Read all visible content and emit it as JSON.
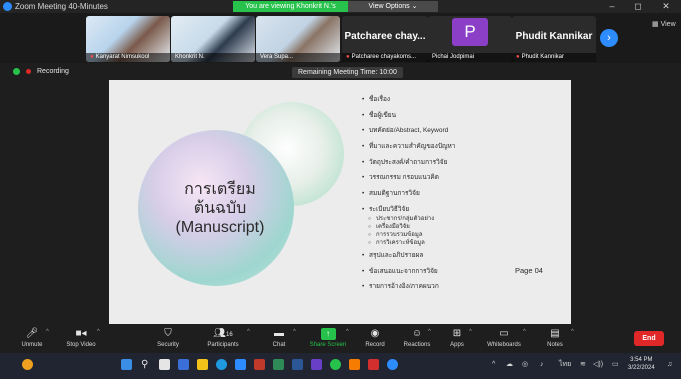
{
  "window": {
    "title": "Zoom Meeting 40-Minutes",
    "viewing_banner": "You are viewing Khonkrit N.'s screen",
    "view_options": "View Options",
    "view_options_caret": "⌄",
    "minimize": "–",
    "maximize": "◻",
    "close": "✕"
  },
  "gallery": {
    "participants": [
      {
        "name": "Kanyarat Nimsukool"
      },
      {
        "name": "Khonkrit N."
      },
      {
        "name": "Vera Supa..."
      },
      {
        "name": "Patcharee chayakoms...",
        "display_name": "Patcharee chay..."
      },
      {
        "name": "Pichai Jodpimai",
        "avatar_letter": "P"
      },
      {
        "name": "Phudit Kannikar",
        "display_name": "Phudit Kannikar"
      }
    ],
    "next_glyph": "›",
    "view_label": "View"
  },
  "status": {
    "recording_label": "Recording",
    "remaining_time": "Remaining Meeting Time: 10:00"
  },
  "slide": {
    "title_line1": "การเตรียม",
    "title_line2": "ต้นฉบับ",
    "title_line3": "(Manuscript)",
    "outline": [
      "ชื่อเรื่อง",
      "ชื่อผู้เขียน",
      "บทคัดย่อ/Abstract, Keyword",
      "ที่มาและความสำคัญของปัญหา",
      "วัตถุประสงค์/คำถามการวิจัย",
      "วรรณกรรม กรอบแนวคิด",
      "สมมติฐานการวิจัย",
      "ระเบียบวิธีวิจัย"
    ],
    "sub_outline": [
      "ประชากร/กลุ่มตัวอย่าง",
      "เครื่องมือวิจัย",
      "การรวบรวมข้อมูล",
      "การวิเคราะห์ข้อมูล"
    ],
    "outline_after": [
      "สรุปและอภิปรายผล",
      "ข้อเสนอแนะจากการวิจัย",
      "รายการอ้างอิง/ภาคผนวก"
    ],
    "page_label": "Page 04"
  },
  "toolbar": {
    "unmute": "Unmute",
    "stop_video": "Stop Video",
    "security": "Security",
    "participants": "Participants",
    "participants_count": "16",
    "chat": "Chat",
    "share_screen": "Share Screen",
    "record": "Record",
    "reactions": "Reactions",
    "apps": "Apps",
    "whiteboards": "Whiteboards",
    "notes": "Notes",
    "end": "End"
  },
  "taskbar": {
    "tray_language": "ไทย",
    "time": "3:54 PM",
    "date": "3/22/2024"
  },
  "colors": {
    "zoom_blue": "#2d8cff",
    "share_green": "#27c24c",
    "end_red": "#e02828",
    "avatar_purple": "#8b3fc7"
  }
}
